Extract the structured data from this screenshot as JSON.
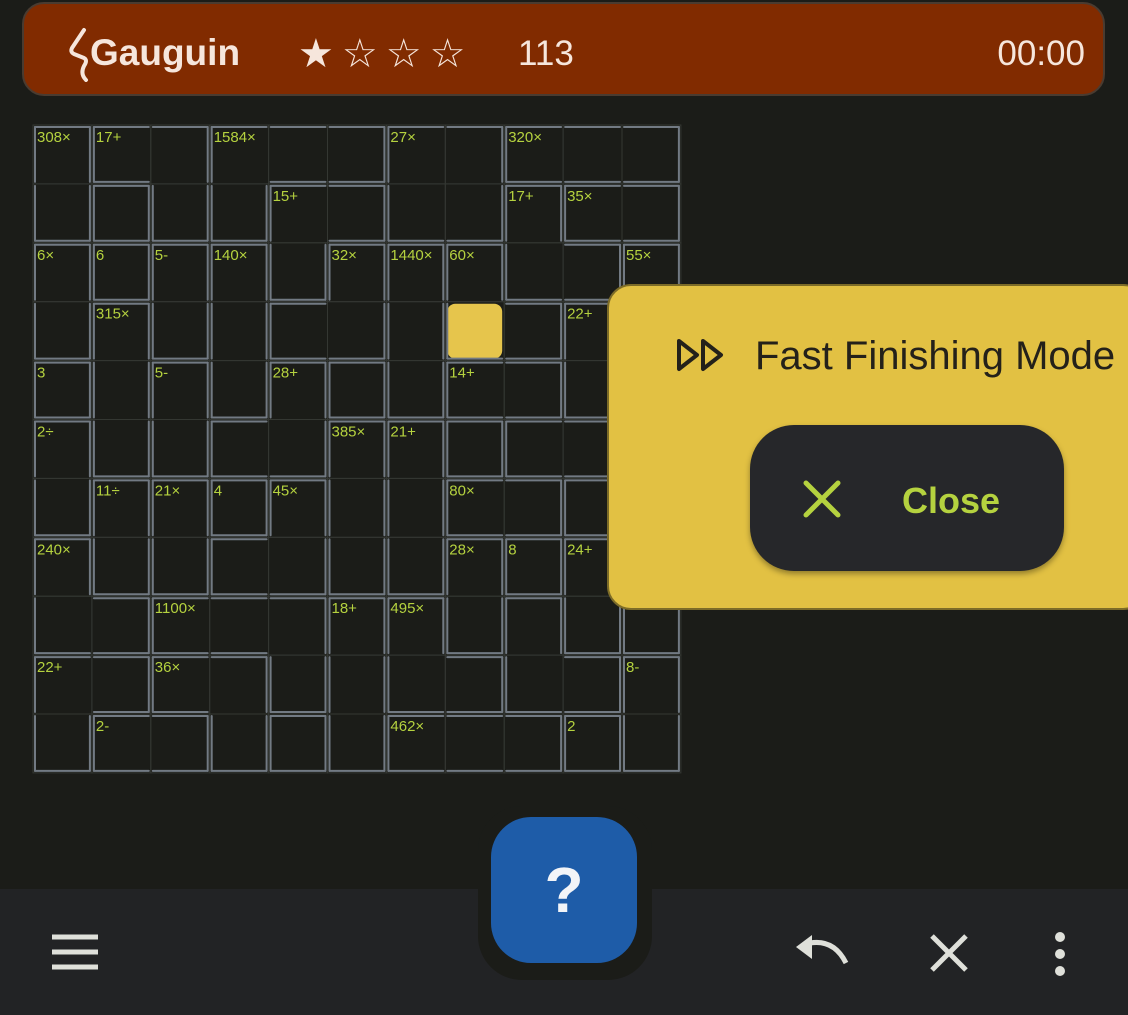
{
  "app": {
    "title": "Gauguin",
    "stars": "★☆☆☆",
    "difficulty_score": "113",
    "timer": "00:00",
    "icon": "gauguin-logo-icon"
  },
  "puzzle": {
    "size": 11,
    "selected_cell": [
      3,
      7
    ],
    "cages": [
      {
        "label": "308×",
        "cells": [
          [
            0,
            0
          ],
          [
            1,
            0
          ]
        ]
      },
      {
        "label": "17+",
        "cells": [
          [
            0,
            1
          ],
          [
            0,
            2
          ],
          [
            1,
            2
          ]
        ]
      },
      {
        "label": "1584×",
        "cells": [
          [
            0,
            3
          ],
          [
            0,
            4
          ],
          [
            0,
            5
          ],
          [
            1,
            3
          ],
          [
            2,
            3
          ]
        ]
      },
      {
        "label": "27×",
        "cells": [
          [
            0,
            6
          ],
          [
            0,
            7
          ],
          [
            1,
            6
          ],
          [
            1,
            7
          ]
        ]
      },
      {
        "label": "320×",
        "cells": [
          [
            0,
            8
          ],
          [
            0,
            9
          ],
          [
            0,
            10
          ]
        ]
      },
      {
        "label": "",
        "cells": [
          [
            1,
            1
          ]
        ]
      },
      {
        "label": "15+",
        "cells": [
          [
            1,
            4
          ],
          [
            1,
            5
          ],
          [
            2,
            4
          ]
        ]
      },
      {
        "label": "17+",
        "cells": [
          [
            1,
            8
          ],
          [
            2,
            8
          ],
          [
            2,
            9
          ]
        ]
      },
      {
        "label": "35×",
        "cells": [
          [
            1,
            9
          ],
          [
            1,
            10
          ]
        ]
      },
      {
        "label": "6×",
        "cells": [
          [
            2,
            0
          ],
          [
            3,
            0
          ]
        ]
      },
      {
        "label": "6",
        "cells": [
          [
            2,
            1
          ]
        ]
      },
      {
        "label": "5-",
        "cells": [
          [
            2,
            2
          ],
          [
            3,
            2
          ]
        ]
      },
      {
        "label": "140×",
        "cells": [
          [
            2,
            3
          ],
          [
            3,
            3
          ],
          [
            4,
            3
          ]
        ]
      },
      {
        "label": "32×",
        "cells": [
          [
            2,
            5
          ],
          [
            3,
            4
          ],
          [
            3,
            5
          ]
        ]
      },
      {
        "label": "1440×",
        "cells": [
          [
            2,
            6
          ],
          [
            3,
            6
          ],
          [
            4,
            6
          ]
        ]
      },
      {
        "label": "60×",
        "cells": [
          [
            2,
            7
          ],
          [
            3,
            7
          ],
          [
            3,
            8
          ]
        ]
      },
      {
        "label": "55×",
        "cells": [
          [
            2,
            10
          ],
          [
            3,
            10
          ]
        ]
      },
      {
        "label": "315×",
        "cells": [
          [
            3,
            1
          ],
          [
            4,
            1
          ],
          [
            5,
            1
          ]
        ]
      },
      {
        "label": "22+",
        "cells": [
          [
            3,
            9
          ],
          [
            4,
            9
          ],
          [
            5,
            9
          ]
        ]
      },
      {
        "label": "3",
        "cells": [
          [
            4,
            0
          ]
        ]
      },
      {
        "label": "5-",
        "cells": [
          [
            4,
            2
          ],
          [
            5,
            2
          ]
        ]
      },
      {
        "label": "28+",
        "cells": [
          [
            4,
            4
          ],
          [
            5,
            4
          ],
          [
            5,
            3
          ]
        ]
      },
      {
        "label": "",
        "cells": [
          [
            4,
            5
          ]
        ]
      },
      {
        "label": "14+",
        "cells": [
          [
            4,
            7
          ],
          [
            4,
            8
          ]
        ]
      },
      {
        "label": "2÷",
        "cells": [
          [
            5,
            0
          ],
          [
            6,
            0
          ]
        ]
      },
      {
        "label": "385×",
        "cells": [
          [
            5,
            5
          ],
          [
            6,
            5
          ],
          [
            7,
            5
          ]
        ]
      },
      {
        "label": "21+",
        "cells": [
          [
            5,
            6
          ],
          [
            6,
            6
          ],
          [
            7,
            6
          ]
        ]
      },
      {
        "label": "",
        "cells": [
          [
            5,
            7
          ],
          [
            6,
            7
          ]
        ]
      },
      {
        "label": "",
        "cells": [
          [
            5,
            8
          ],
          [
            5,
            9
          ]
        ]
      },
      {
        "label": "11÷",
        "cells": [
          [
            6,
            1
          ],
          [
            7,
            1
          ]
        ]
      },
      {
        "label": "21×",
        "cells": [
          [
            6,
            2
          ],
          [
            7,
            2
          ]
        ]
      },
      {
        "label": "4",
        "cells": [
          [
            6,
            3
          ]
        ]
      },
      {
        "label": "45×",
        "cells": [
          [
            6,
            4
          ],
          [
            7,
            4
          ],
          [
            7,
            3
          ]
        ]
      },
      {
        "label": "80×",
        "cells": [
          [
            6,
            7
          ],
          [
            6,
            8
          ]
        ]
      },
      {
        "label": "",
        "cells": [
          [
            6,
            9
          ],
          [
            6,
            10
          ]
        ]
      },
      {
        "label": "240×",
        "cells": [
          [
            7,
            0
          ],
          [
            8,
            0
          ],
          [
            8,
            1
          ]
        ]
      },
      {
        "label": "28×",
        "cells": [
          [
            7,
            7
          ],
          [
            8,
            7
          ]
        ]
      },
      {
        "label": "8",
        "cells": [
          [
            7,
            8
          ]
        ]
      },
      {
        "label": "24+",
        "cells": [
          [
            7,
            9
          ],
          [
            8,
            9
          ],
          [
            7,
            10
          ]
        ]
      },
      {
        "label": "1100×",
        "cells": [
          [
            8,
            2
          ],
          [
            8,
            3
          ],
          [
            8,
            4
          ],
          [
            9,
            4
          ]
        ]
      },
      {
        "label": "18+",
        "cells": [
          [
            8,
            5
          ],
          [
            9,
            5
          ],
          [
            10,
            5
          ]
        ]
      },
      {
        "label": "495×",
        "cells": [
          [
            8,
            6
          ],
          [
            9,
            6
          ],
          [
            9,
            7
          ]
        ]
      },
      {
        "label": "",
        "cells": [
          [
            8,
            8
          ],
          [
            9,
            8
          ],
          [
            9,
            9
          ]
        ]
      },
      {
        "label": "",
        "cells": [
          [
            8,
            10
          ]
        ]
      },
      {
        "label": "22+",
        "cells": [
          [
            9,
            0
          ],
          [
            9,
            1
          ],
          [
            10,
            0
          ]
        ]
      },
      {
        "label": "36×",
        "cells": [
          [
            9,
            2
          ],
          [
            9,
            3
          ],
          [
            10,
            3
          ]
        ]
      },
      {
        "label": "8-",
        "cells": [
          [
            9,
            10
          ],
          [
            10,
            10
          ]
        ]
      },
      {
        "label": "2-",
        "cells": [
          [
            10,
            1
          ],
          [
            10,
            2
          ]
        ]
      },
      {
        "label": "",
        "cells": [
          [
            10,
            4
          ]
        ]
      },
      {
        "label": "462×",
        "cells": [
          [
            10,
            6
          ],
          [
            10,
            7
          ],
          [
            10,
            8
          ]
        ]
      },
      {
        "label": "2",
        "cells": [
          [
            10,
            9
          ]
        ]
      }
    ]
  },
  "overlay": {
    "icon": "fast-forward-icon",
    "title": "Fast Finishing Mode",
    "close_icon": "close-icon",
    "close_label": "Close"
  },
  "bottom_bar": {
    "help_label": "?",
    "menu_icon": "menu-icon",
    "undo_icon": "undo-icon",
    "clear_icon": "clear-icon",
    "more_icon": "more-vert-icon"
  },
  "colors": {
    "background": "#1b1c18",
    "topbar": "#812b00",
    "cage_label": "#b5d23f",
    "overlay": "#e2c143",
    "selected_cell": "#e6c54c",
    "fab": "#1e5ca8",
    "bottom_bar": "#222325"
  }
}
